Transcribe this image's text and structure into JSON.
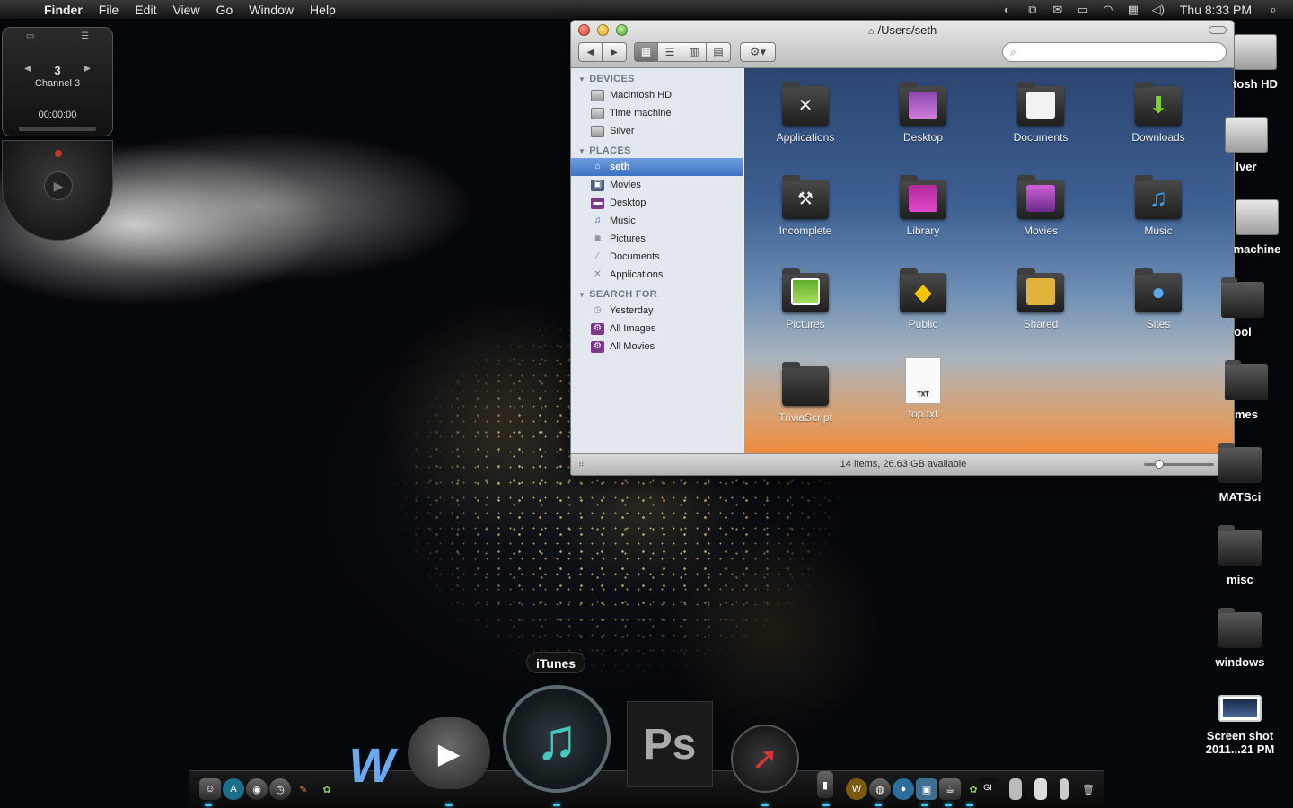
{
  "menubar": {
    "apple_glyph": "",
    "items": [
      "Finder",
      "File",
      "Edit",
      "View",
      "Go",
      "Window",
      "Help"
    ],
    "clock": "Thu 8:33 PM",
    "status_icons": [
      "time-machine-icon",
      "spaces-icon",
      "mail-icon",
      "display-icon",
      "wifi-icon",
      "calendar-icon",
      "volume-icon",
      "spotlight-icon"
    ]
  },
  "radio_widget": {
    "channel_number": "3",
    "channel_name": "Channel 3",
    "time": "00:00:00"
  },
  "finder": {
    "title": "/Users/seth",
    "search_placeholder": "",
    "sidebar": {
      "devices_header": "DEVICES",
      "devices": [
        "Macintosh HD",
        "Time machine",
        "Silver"
      ],
      "places_header": "PLACES",
      "places": [
        "seth",
        "Movies",
        "Desktop",
        "Music",
        "Pictures",
        "Documents",
        "Applications"
      ],
      "selected": "seth",
      "search_header": "SEARCH FOR",
      "searches": [
        "Yesterday",
        "All Images",
        "All Movies"
      ]
    },
    "items": [
      "Applications",
      "Desktop",
      "Documents",
      "Downloads",
      "Incomplete",
      "Library",
      "Movies",
      "Music",
      "Pictures",
      "Public",
      "Shared",
      "Sites",
      "TriviaScript",
      "top.txt"
    ],
    "txt_label": "TXT",
    "status": "14 items, 26.63 GB available"
  },
  "desktop_icons": [
    "tosh HD",
    "lver",
    "machine",
    "ool",
    "mes",
    "MATSci",
    "misc",
    "windows",
    "Screen shot\n2011...21 PM"
  ],
  "dock": {
    "tooltip": "iTunes",
    "ps_label": "Ps",
    "wu_label": "W"
  }
}
